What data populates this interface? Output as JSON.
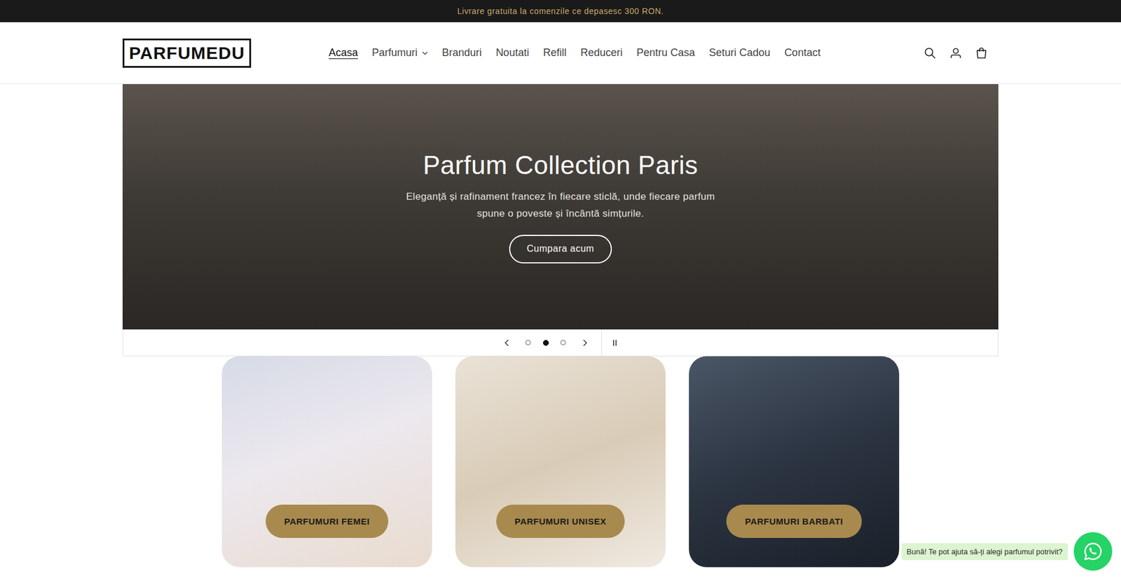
{
  "announcement": "Livrare gratuita la comenzile ce depasesc 300 RON.",
  "logo": "PARFUMEDU",
  "nav": [
    {
      "label": "Acasa",
      "selected": true,
      "dropdown": false
    },
    {
      "label": "Parfumuri",
      "selected": false,
      "dropdown": true
    },
    {
      "label": "Branduri",
      "selected": false,
      "dropdown": false
    },
    {
      "label": "Noutati",
      "selected": false,
      "dropdown": false
    },
    {
      "label": "Refill",
      "selected": false,
      "dropdown": false
    },
    {
      "label": "Reduceri",
      "selected": false,
      "dropdown": false
    },
    {
      "label": "Pentru Casa",
      "selected": false,
      "dropdown": false
    },
    {
      "label": "Seturi Cadou",
      "selected": false,
      "dropdown": false
    },
    {
      "label": "Contact",
      "selected": false,
      "dropdown": false
    }
  ],
  "hero": {
    "title": "Parfum Collection Paris",
    "subtitle": "Eleganță și rafinament francez în fiecare sticlă, unde fiecare parfum spune o poveste și încântă simțurile.",
    "button": "Cumpara acum"
  },
  "slider": {
    "slides": [
      {
        "selected": false
      },
      {
        "selected": true
      },
      {
        "selected": false
      }
    ],
    "playing": true
  },
  "categories": [
    {
      "label": "PARFUMURI FEMEI"
    },
    {
      "label": "PARFUMURI UNISEX"
    },
    {
      "label": "PARFUMURI BARBATI"
    }
  ],
  "chat": {
    "message": "Bună! Te pot ajuta să-ți alegi parfumul potrivit?"
  }
}
